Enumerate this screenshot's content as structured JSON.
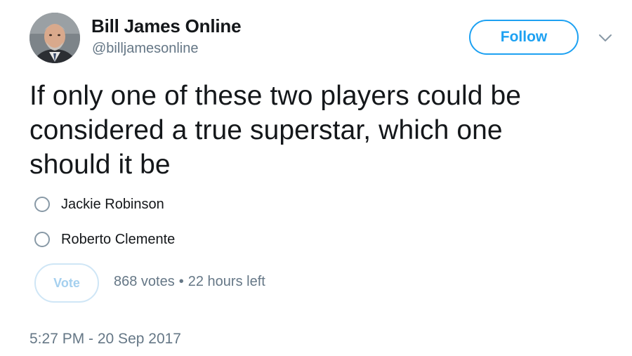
{
  "author": {
    "display_name": "Bill James Online",
    "handle": "@billjamesonline"
  },
  "header": {
    "follow_label": "Follow",
    "menu_icon": "chevron-down-icon"
  },
  "tweet": {
    "text": "If only one of these two players could be considered a true superstar, which one should it be"
  },
  "poll": {
    "options": [
      {
        "label": "Jackie Robinson"
      },
      {
        "label": "Roberto Clemente"
      }
    ],
    "vote_label": "Vote",
    "votes": "868 votes",
    "separator": "•",
    "time_left": "22 hours left"
  },
  "timestamp": "5:27 PM - 20 Sep 2017",
  "colors": {
    "accent": "#1da1f2",
    "text": "#14171a",
    "secondary": "#657786"
  }
}
